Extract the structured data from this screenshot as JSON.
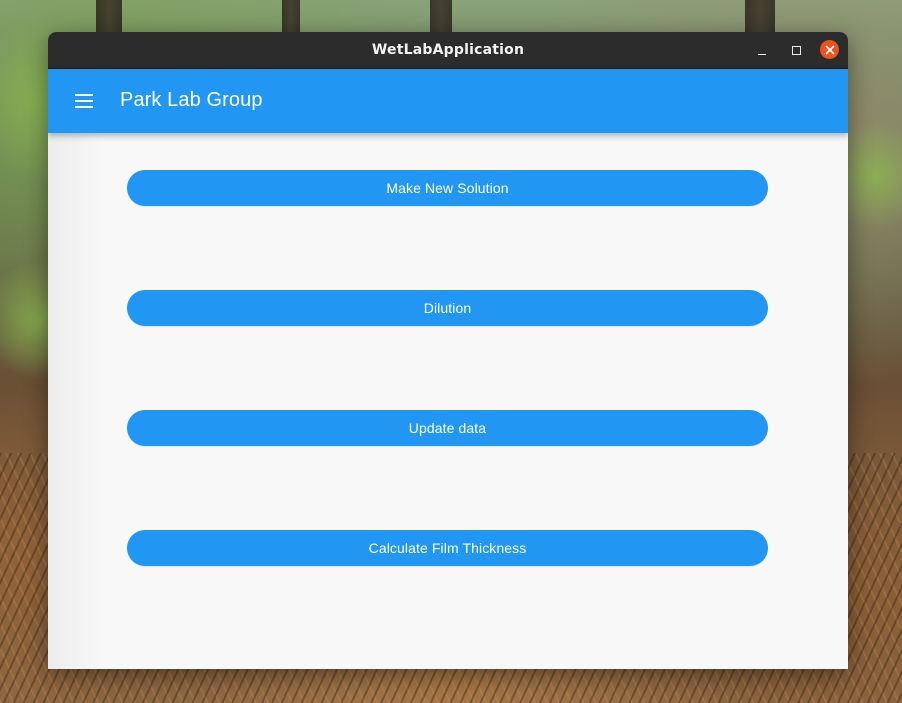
{
  "window": {
    "title": "WetLabApplication",
    "controls": {
      "minimize": "minimize-icon",
      "maximize": "maximize-icon",
      "close": "close-icon"
    }
  },
  "appbar": {
    "menu_icon": "hamburger-menu-icon",
    "title": "Park Lab Group",
    "color": "#2196f3"
  },
  "main": {
    "buttons": [
      {
        "label": "Make New Solution"
      },
      {
        "label": "Dilution"
      },
      {
        "label": "Update data"
      },
      {
        "label": "Calculate Film Thickness"
      }
    ]
  },
  "colors": {
    "accent": "#2196f3",
    "titlebar": "#2c2c2c",
    "close_button": "#e95420",
    "content_background": "#f8f8f8"
  }
}
